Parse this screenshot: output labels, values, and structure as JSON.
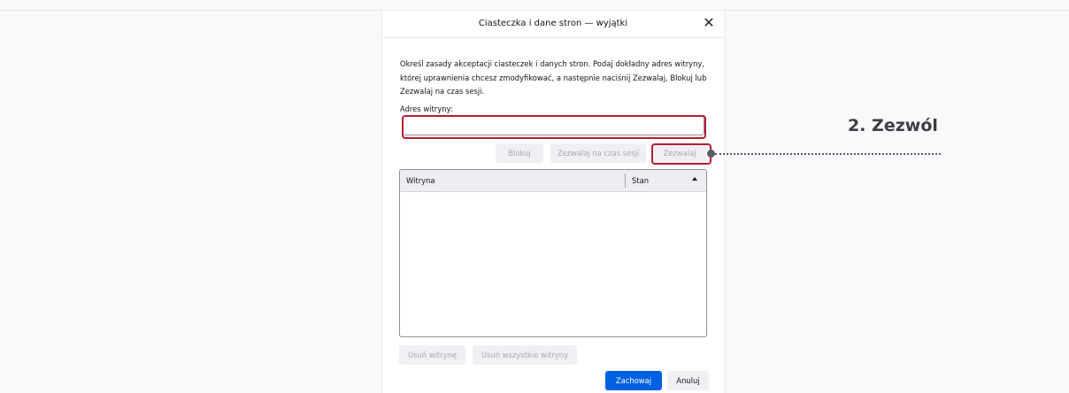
{
  "dialog": {
    "title": "Ciasteczka i dane stron — wyjątki",
    "description": "Określ zasady akceptacji ciasteczek i danych stron. Podaj dokładny adres witryny, której uprawnienia chcesz zmodyfikować, a następnie naciśnij Zezwalaj, Blokuj lub Zezwalaj na czas sesji.",
    "address_label": "Adres witryny:",
    "address_value": "",
    "buttons": {
      "block": "Blokuj",
      "allow_session": "Zezwalaj na czas sesji",
      "allow": "Zezwalaj",
      "remove_site": "Usuń witrynę",
      "remove_all": "Usuń wszystkie witryny",
      "save": "Zachowaj",
      "cancel": "Anuluj"
    },
    "table": {
      "columns": [
        "Witryna",
        "Stan"
      ],
      "rows": []
    },
    "close_icon": "close-icon",
    "sort_icon": "sort-ascending-icon"
  },
  "annotation": {
    "label": "2. Zezwól",
    "highlight_color": "#b71c34",
    "callout_color": "#5b5b66"
  },
  "colors": {
    "primary": "#0061e0",
    "background": "#f9f9fb"
  }
}
